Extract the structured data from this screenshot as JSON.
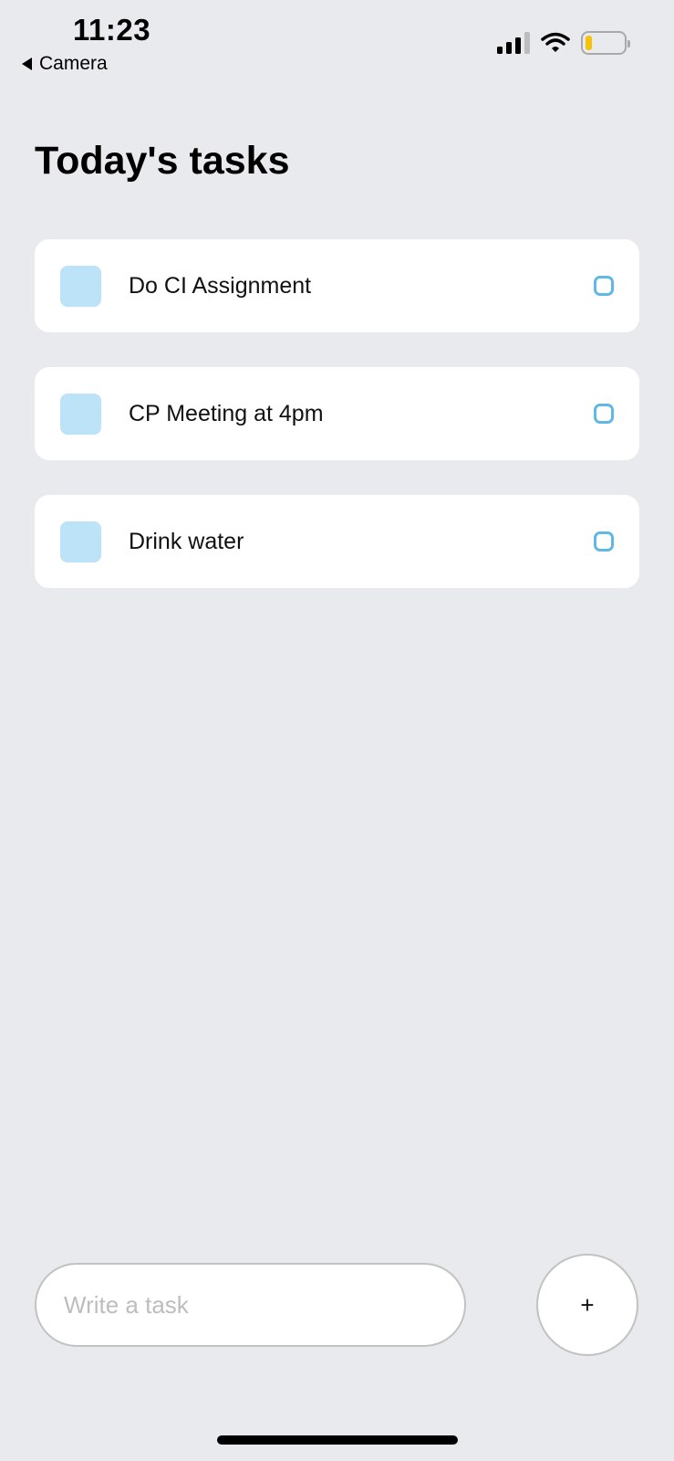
{
  "status_bar": {
    "time": "11:23",
    "back_label": "Camera",
    "icons": [
      "cellular-signal-icon",
      "wifi-icon",
      "battery-low-icon"
    ],
    "battery_color": "#f7c10a"
  },
  "header": {
    "title": "Today's tasks"
  },
  "tasks": [
    {
      "label": "Do CI Assignment"
    },
    {
      "label": "CP Meeting at 4pm"
    },
    {
      "label": "Drink water"
    }
  ],
  "composer": {
    "placeholder": "Write a task",
    "value": "",
    "add_label": "+"
  },
  "colors": {
    "background": "#e8eaed",
    "card": "#ffffff",
    "task_square": "#bde3f8",
    "task_circle": "#5fb8e6"
  }
}
